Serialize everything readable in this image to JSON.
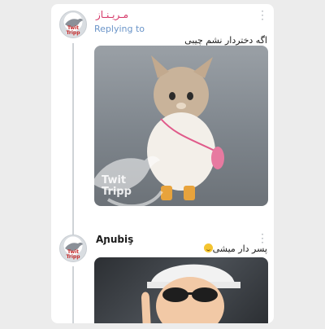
{
  "tweet1": {
    "author": "مـریـنـاز",
    "replying": "Replying to",
    "text": "اگه دختردار نشم چیبی"
  },
  "watermark": {
    "line1": "Twit",
    "line2": "Tripp"
  },
  "avatar": {
    "logo_line1": "Twit",
    "logo_line2": "Tripp"
  },
  "tweet2": {
    "author": "Aɲubiş",
    "text": "پسر دار میشی"
  },
  "colors": {
    "author_name": "#d63a6a",
    "replying_link": "#6b95c9",
    "thread_line": "#cfd3d7"
  },
  "icons": [
    "more-options-icon",
    "bird-logo-icon",
    "smile-emoji-icon"
  ]
}
